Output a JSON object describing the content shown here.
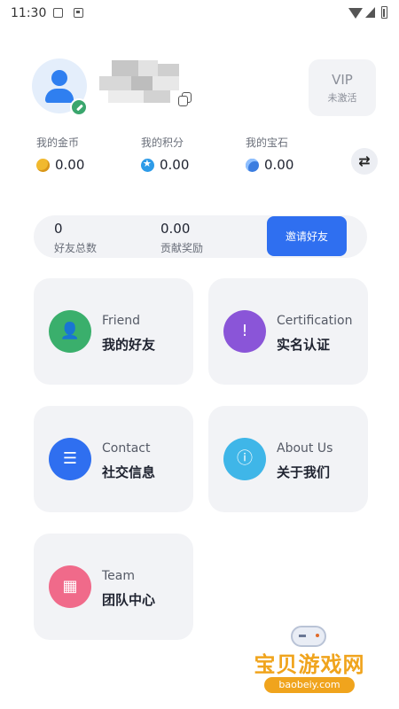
{
  "status_bar": {
    "time": "11:30"
  },
  "profile": {
    "name": ""
  },
  "vip": {
    "title": "VIP",
    "status": "未激活"
  },
  "wallet": [
    {
      "label": "我的金币",
      "value": "0.00",
      "icon": "coin-icon"
    },
    {
      "label": "我的积分",
      "value": "0.00",
      "icon": "points-icon"
    },
    {
      "label": "我的宝石",
      "value": "0.00",
      "icon": "gem-icon"
    }
  ],
  "invite": {
    "total_friends_value": "0",
    "total_friends_label": "好友总数",
    "reward_value": "0.00",
    "reward_label": "贡献奖励",
    "button_label": "邀请好友"
  },
  "menu": [
    {
      "en": "Friend",
      "cn": "我的好友",
      "icon": "person-icon",
      "color": "#3aaf6c"
    },
    {
      "en": "Certification",
      "cn": "实名认证",
      "icon": "shield-icon",
      "color": "#8a55d8"
    },
    {
      "en": "Contact",
      "cn": "社交信息",
      "icon": "chat-icon",
      "color": "#2f6ff0"
    },
    {
      "en": "About Us",
      "cn": "关于我们",
      "icon": "info-icon",
      "color": "#3fb6e8"
    },
    {
      "en": "Team",
      "cn": "团队中心",
      "icon": "grid-icon",
      "color": "#f06a8a"
    }
  ],
  "watermark": {
    "brand": "宝贝游戏网",
    "url": "baobeiy.com"
  }
}
